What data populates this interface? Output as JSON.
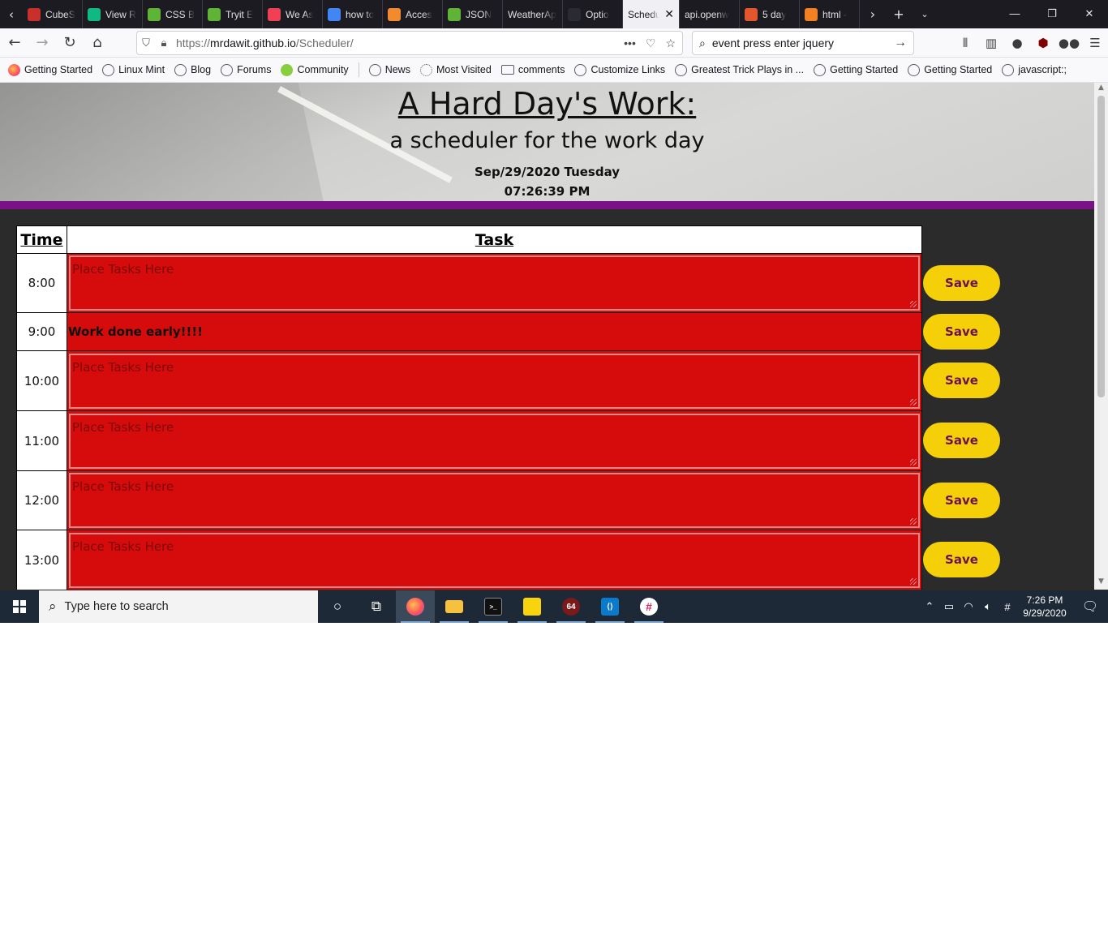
{
  "browser": {
    "tabs": [
      {
        "label": "CubeS",
        "icon": "cube-icon",
        "color": "#c9302c"
      },
      {
        "label": "View R",
        "icon": "view-icon",
        "color": "#10b981"
      },
      {
        "label": "CSS B",
        "icon": "w3-icon",
        "color": "#5fb336"
      },
      {
        "label": "Tryit E",
        "icon": "w3-icon",
        "color": "#5fb336"
      },
      {
        "label": "We As",
        "icon": "pocket-icon",
        "color": "#ef4056"
      },
      {
        "label": "how to",
        "icon": "google-icon",
        "color": "#4285f4"
      },
      {
        "label": "Acces",
        "icon": "orange-square-icon",
        "color": "#f28a30"
      },
      {
        "label": "JSON",
        "icon": "w3-icon",
        "color": "#5fb336"
      },
      {
        "label": "WeatherAp",
        "icon": "",
        "color": ""
      },
      {
        "label": "Optio",
        "icon": "dark-icon",
        "color": "#2a2a33"
      },
      {
        "label": "Schedu",
        "icon": "",
        "color": "",
        "active": true
      },
      {
        "label": "api.openw",
        "icon": "",
        "color": ""
      },
      {
        "label": "5 day",
        "icon": "weather-icon",
        "color": "#e4572e"
      },
      {
        "label": "html -",
        "icon": "stackoverflow-icon",
        "color": "#f48024"
      }
    ],
    "url": {
      "proto": "https://",
      "host": "mrdawit.github.io",
      "path": "/Scheduler/"
    },
    "search_value": "event press enter jquery",
    "bookmarks": [
      {
        "label": "Getting Started",
        "icon": "firefox-icon"
      },
      {
        "label": "Linux Mint",
        "icon": "globe-icon"
      },
      {
        "label": "Blog",
        "icon": "globe-icon"
      },
      {
        "label": "Forums",
        "icon": "globe-icon"
      },
      {
        "label": "Community",
        "icon": "mint-icon"
      },
      {
        "label": "News",
        "icon": "globe-icon"
      },
      {
        "label": "Most Visited",
        "icon": "gear-icon"
      },
      {
        "label": "comments",
        "icon": "folder-icon"
      },
      {
        "label": "Customize Links",
        "icon": "globe-icon"
      },
      {
        "label": "Greatest Trick Plays in ...",
        "icon": "globe-icon"
      },
      {
        "label": "Getting Started",
        "icon": "globe-icon"
      },
      {
        "label": "Getting Started",
        "icon": "globe-icon"
      },
      {
        "label": "javascript:;",
        "icon": "globe-icon"
      }
    ]
  },
  "page": {
    "title": "A Hard Day's Work:",
    "subtitle": "a scheduler for the work day",
    "date": "Sep/29/2020 Tuesday",
    "time": "07:26:39 PM",
    "accent_color": "#7a1187",
    "past_color": "#d60b0b",
    "save_color": "#f5cf07",
    "table": {
      "headers": {
        "time": "Time",
        "task": "Task"
      },
      "placeholder": "Place Tasks Here",
      "save_label": "Save",
      "rows": [
        {
          "time": "8:00",
          "task": "",
          "editable": true
        },
        {
          "time": "9:00",
          "task": "Work done early!!!!",
          "editable": false
        },
        {
          "time": "10:00",
          "task": "",
          "editable": true
        },
        {
          "time": "11:00",
          "task": "",
          "editable": true
        },
        {
          "time": "12:00",
          "task": "",
          "editable": true
        },
        {
          "time": "13:00",
          "task": "",
          "editable": true
        }
      ]
    }
  },
  "taskbar": {
    "search_placeholder": "Type here to search",
    "clock_time": "7:26 PM",
    "clock_date": "9/29/2020"
  }
}
